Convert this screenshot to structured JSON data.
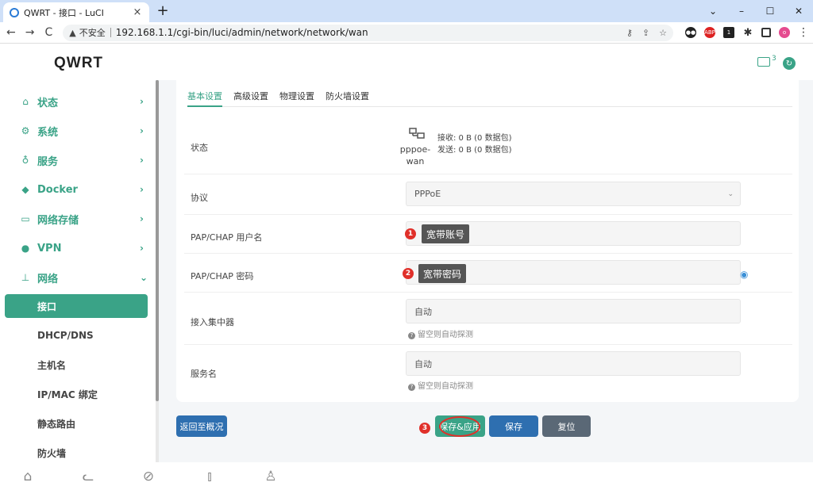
{
  "browser": {
    "tab_title": "QWRT - 接口 - LuCI",
    "tab_close": "×",
    "new_tab": "+",
    "insecure_label": "不安全",
    "url": "192.168.1.1/cgi-bin/luci/admin/network/network/wan",
    "ext_abp": "ABP",
    "ext_badge": "1",
    "profile_initial": "o"
  },
  "app": {
    "brand": "QWRT",
    "header_badge": "3"
  },
  "sidebar": {
    "items": [
      {
        "label": "状态",
        "icon": "home-icon"
      },
      {
        "label": "系统",
        "icon": "gear-icon"
      },
      {
        "label": "服务",
        "icon": "user-icon"
      },
      {
        "label": "Docker",
        "icon": "docker-icon"
      },
      {
        "label": "网络存储",
        "icon": "storage-icon"
      },
      {
        "label": "VPN",
        "icon": "vpn-icon"
      },
      {
        "label": "网络",
        "icon": "network-icon"
      }
    ],
    "subitems": [
      {
        "label": "接口",
        "active": true
      },
      {
        "label": "DHCP/DNS"
      },
      {
        "label": "主机名"
      },
      {
        "label": "IP/MAC 绑定"
      },
      {
        "label": "静态路由"
      },
      {
        "label": "防火墙"
      }
    ]
  },
  "tabs": [
    "基本设置",
    "高级设置",
    "物理设置",
    "防火墙设置"
  ],
  "form": {
    "status_label": "状态",
    "status_iface_line1": "pppoe-",
    "status_iface_line2": "wan",
    "status_rx": "接收: 0 B (0 数据包)",
    "status_tx": "发送: 0 B (0 数据包)",
    "protocol_label": "协议",
    "protocol_value": "PPPoE",
    "username_label": "PAP/CHAP 用户名",
    "password_label": "PAP/CHAP 密码",
    "ac_label": "接入集中器",
    "ac_value": "自动",
    "ac_hint": "留空则自动探测",
    "service_label": "服务名",
    "service_value": "自动",
    "service_hint": "留空则自动探测"
  },
  "annotations": {
    "badge1": "1",
    "callout1": "宽带账号",
    "badge2": "2",
    "callout2": "宽带密码",
    "badge3": "3"
  },
  "actions": {
    "back": "返回至概况",
    "save_apply": "保存&应用",
    "save": "保存",
    "reset": "复位"
  },
  "colors": {
    "accent": "#3aa387",
    "primary_button": "#2e6fb0",
    "reset_button": "#5a6876",
    "annotation_red": "#e0302a"
  }
}
